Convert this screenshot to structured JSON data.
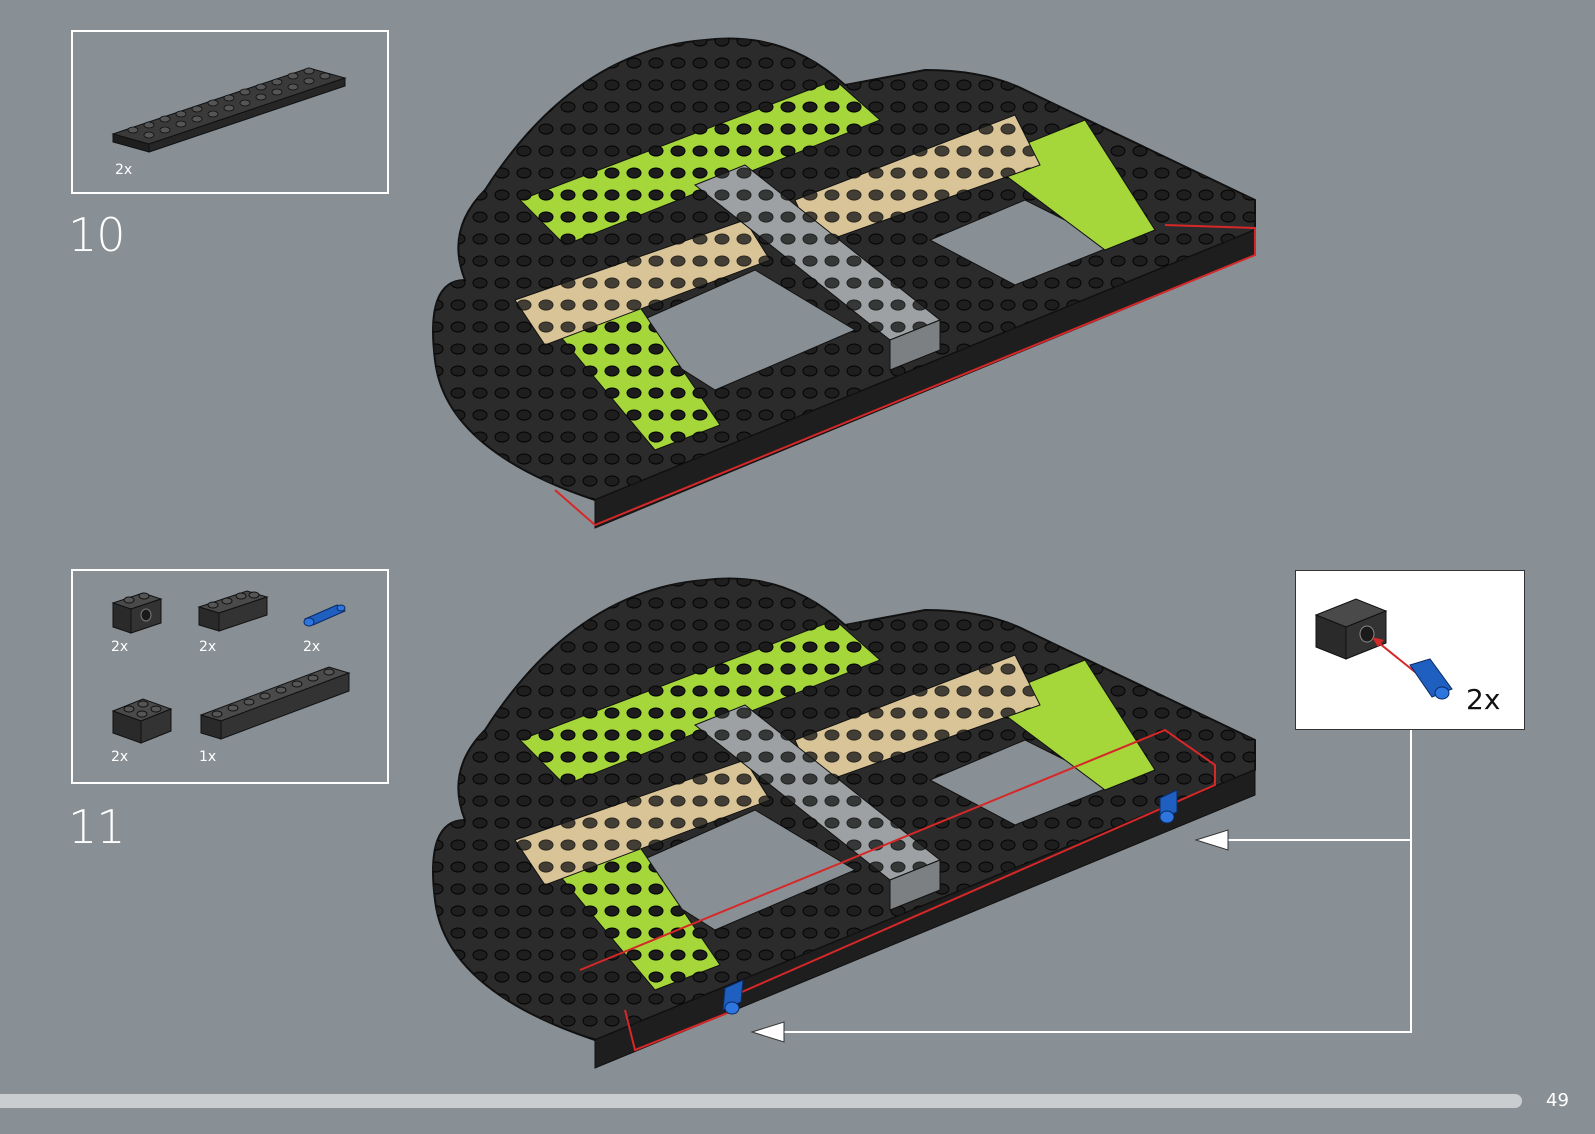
{
  "page": {
    "number": "49",
    "progress": 0.955
  },
  "steps": [
    {
      "number": "10",
      "parts": [
        {
          "name": "plate-2x12",
          "color": "#2b2b2b",
          "quantity": "2x"
        }
      ]
    },
    {
      "number": "11",
      "parts": [
        {
          "name": "technic-brick-1x2-with-hole",
          "color": "#2b2b2b",
          "quantity": "2x"
        },
        {
          "name": "brick-1x4",
          "color": "#2b2b2b",
          "quantity": "2x"
        },
        {
          "name": "technic-axle-pin",
          "color": "#1f5fbf",
          "quantity": "2x"
        },
        {
          "name": "brick-2x2",
          "color": "#2b2b2b",
          "quantity": "2x"
        },
        {
          "name": "brick-1x8",
          "color": "#2b2b2b",
          "quantity": "1x"
        }
      ],
      "callout": {
        "quantity": "2x"
      }
    }
  ],
  "colors": {
    "background": "#899095",
    "dark-gray": "#2b2b2b",
    "lime": "#a5d63a",
    "tan": "#d8c497",
    "light-gray": "#9ea1a3",
    "highlight": "#d62828",
    "blue": "#1f5fbf"
  }
}
